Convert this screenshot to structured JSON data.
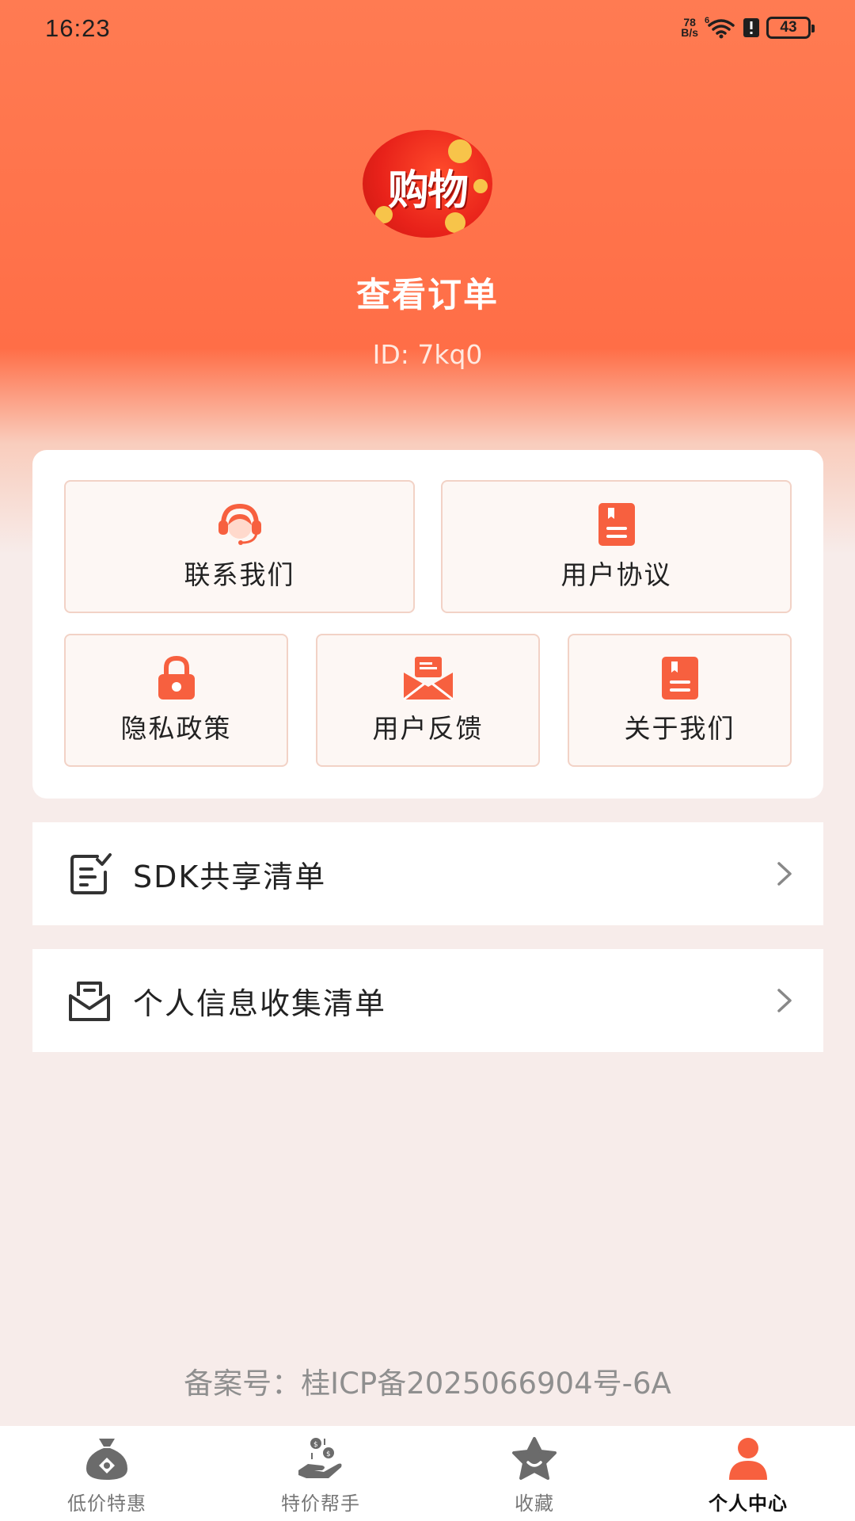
{
  "status_bar": {
    "time": "16:23",
    "net_speed_value": "78",
    "net_speed_unit": "B/s",
    "wifi_signal": "6",
    "battery": "43"
  },
  "profile": {
    "avatar_text": "购物",
    "name": "查看订单",
    "id": "ID: 7kq0"
  },
  "grid": {
    "contact_label": "联系我们",
    "agreement_label": "用户协议",
    "privacy_label": "隐私政策",
    "feedback_label": "用户反馈",
    "about_label": "关于我们"
  },
  "list": {
    "sdk_label": "SDK共享清单",
    "personal_info_label": "个人信息收集清单"
  },
  "icp": "备案号：桂ICP备2025066904号-6A",
  "bottom_nav": {
    "items": [
      {
        "label": "低价特惠",
        "icon": "money-bag-icon"
      },
      {
        "label": "特价帮手",
        "icon": "hand-coins-icon"
      },
      {
        "label": "收藏",
        "icon": "star-icon"
      },
      {
        "label": "个人中心",
        "icon": "person-icon"
      }
    ],
    "active_index": 3
  },
  "colors": {
    "accent": "#f7603f",
    "header": "#ff6e47",
    "inactive_icon": "#6b6b6b"
  }
}
